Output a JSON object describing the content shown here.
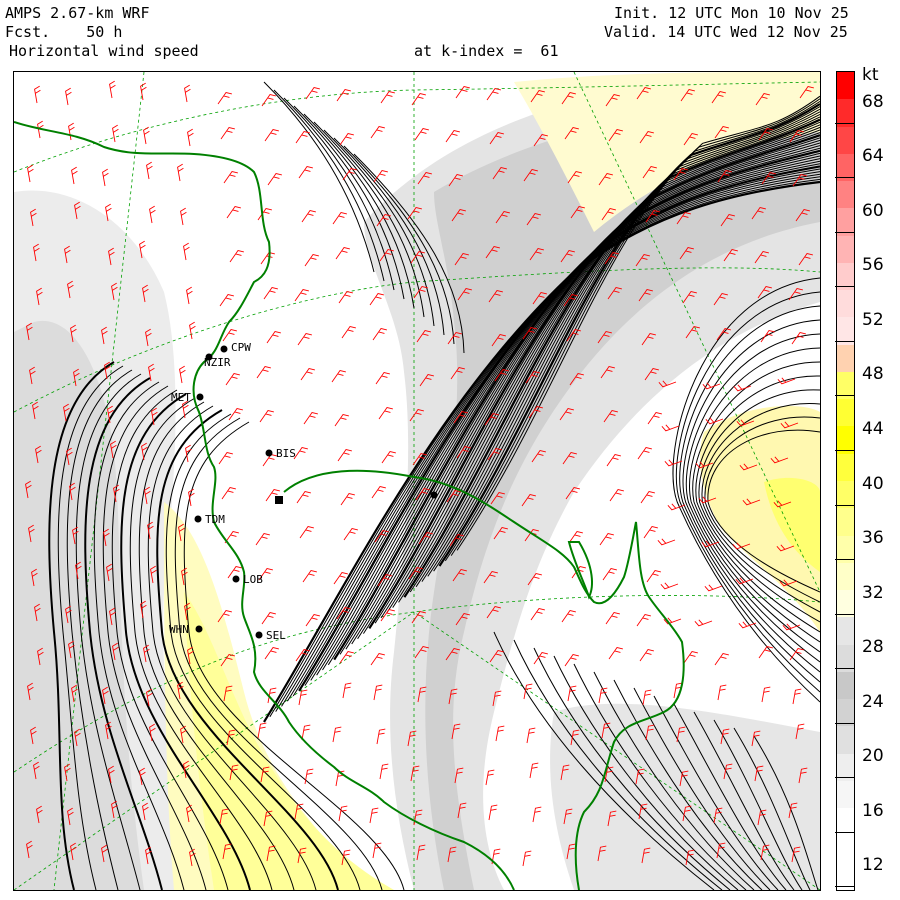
{
  "header": {
    "model": "AMPS 2.67-km WRF",
    "fcst": "Fcst.    50 h",
    "field": "Horizontal wind speed",
    "level": "at k-index =  61",
    "init": "Init. 12 UTC Mon 10 Nov 25",
    "valid": "Valid. 14 UTC Wed 12 Nov 25"
  },
  "colorbar": {
    "unit": "kt",
    "labels": [
      "68",
      "64",
      "60",
      "56",
      "52",
      "48",
      "44",
      "40",
      "36",
      "32",
      "28",
      "24",
      "20",
      "16",
      "12"
    ],
    "colors": [
      "#ff0000",
      "#ff2a2a",
      "#ff4646",
      "#ff6464",
      "#ff8282",
      "#ffa0a0",
      "#ffb4b4",
      "#ffcccc",
      "#ffdcdc",
      "#ffe6e6",
      "#ffd2b0",
      "#ffff66",
      "#ffff33",
      "#ffff00",
      "#ffff3c",
      "#ffff66",
      "#ffff8c",
      "#ffffaa",
      "#ffffc8",
      "#ffffe0",
      "#e6e6e6",
      "#dcdcdc",
      "#c8c8c8",
      "#d2d2d2",
      "#e0e0e0",
      "#eeeeee",
      "#f6f6f6",
      "#ffffff",
      "#ffffff",
      "#ffffff"
    ]
  },
  "stations": [
    {
      "name": "CPW"
    },
    {
      "name": "NZIR"
    },
    {
      "name": "MET"
    },
    {
      "name": "BIS"
    },
    {
      "name": "TDM"
    },
    {
      "name": "LOB"
    },
    {
      "name": "WHN"
    },
    {
      "name": "SEL"
    },
    {
      "name": ""
    },
    {
      "name": ""
    }
  ],
  "styles": {
    "coastline": "#008000",
    "barbs": "#ff0000",
    "streamlines": "#000000",
    "gridlines": "#00a000",
    "shade_light": "#ffffc0",
    "shade_gray": "#d8d8d8"
  }
}
